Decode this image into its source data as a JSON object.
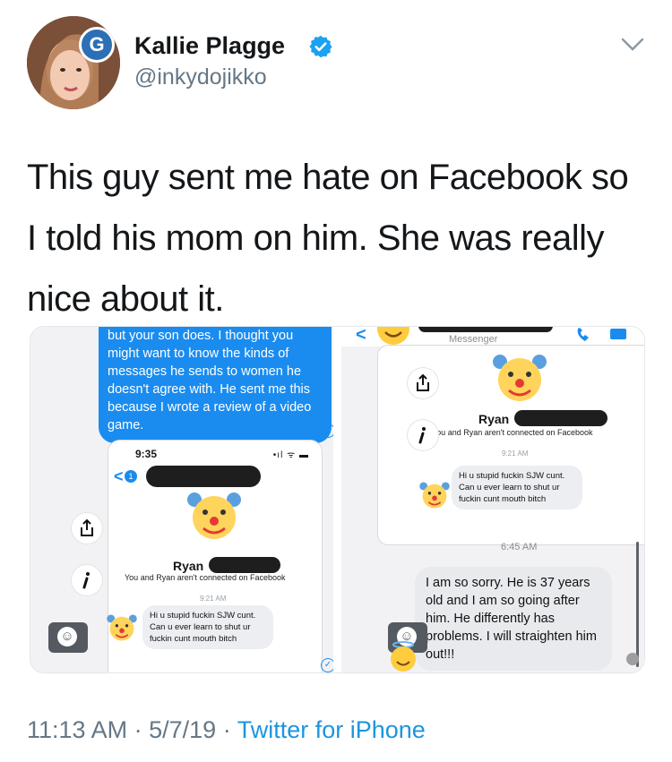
{
  "tweet": {
    "author_name": "Kallie Plagge",
    "author_handle": "@inkydojikko",
    "text": "This guy sent me hate on Facebook so I told his mom on him. She was really nice about it.",
    "time": "11:13 AM",
    "date": "5/7/19",
    "separator": "·",
    "source": "Twitter for iPhone",
    "avatar_badge": "G"
  },
  "screenshot_left": {
    "sent_message": "but your son does. I thought you might want to know the kinds of messages he sends to women he doesn't agree with. He sent me this because I wrote a review of a video game.",
    "phone_time": "9:35",
    "phone_status": "•ıl ᯤ ▬",
    "back_badge": "1",
    "contact_name": "Ryan",
    "connection_note": "You and Ryan aren't connected on Facebook",
    "message_time": "9:21 AM",
    "received_message": "Hi u stupid fuckin SJW cunt. Can u ever learn to shut ur fuckin cunt mouth bitch"
  },
  "screenshot_right": {
    "app_label": "Messenger",
    "contact_name": "Ryan",
    "connection_note": "You and Ryan aren't connected on Facebook",
    "message_time": "9:21 AM",
    "received_message": "Hi u stupid fuckin SJW cunt. Can u ever learn to shut ur fuckin cunt mouth bitch",
    "reply_time": "6:45 AM",
    "reply_message": "I am so sorry. He is 37 years old and I am so going after him. He differently has problems. I will straighten him out!!!"
  },
  "icons": {
    "verified": "verified-badge-icon",
    "chevron": "chevron-down-icon",
    "share": "share-icon",
    "info": "info-icon",
    "emoji": "emoji-icon",
    "clown": "clown-face-icon",
    "back": "back-arrow-icon",
    "phone": "phone-call-icon",
    "video": "video-call-icon",
    "angel": "smiling-face-with-halo-icon"
  },
  "colors": {
    "twitter_blue": "#1b95e0",
    "messenger_blue": "#1a8cf0",
    "secondary_text": "#657786"
  }
}
